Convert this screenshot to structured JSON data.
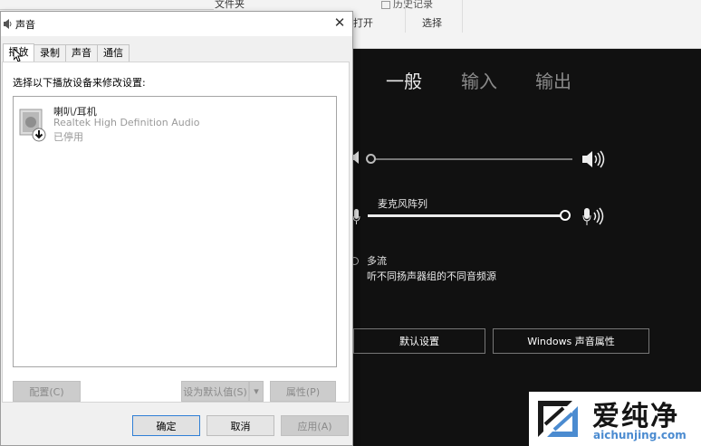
{
  "background_ribbon": {
    "folder_label": "文件夹",
    "open_label": "打开",
    "history_label": "历史记录",
    "select_label": "选择"
  },
  "settings_panel": {
    "tabs": [
      "一般",
      "输入",
      "输出"
    ],
    "output_volume_percent": 0,
    "mic_label": "麦克风阵列",
    "mic_volume_percent": 100,
    "multi_stream_label": "多流",
    "multi_stream_desc": "听不同扬声器组的不同音频源",
    "default_settings_button": "默认设置",
    "windows_sound_props_button": "Windows 声音属性"
  },
  "dialog": {
    "title": "声音",
    "tabs": [
      "播放",
      "录制",
      "声音",
      "通信"
    ],
    "instruction": "选择以下播放设备来修改设置:",
    "devices": [
      {
        "name": "喇叭/耳机",
        "driver": "Realtek High Definition Audio",
        "status": "已停用"
      }
    ],
    "buttons": {
      "configure": "配置(C)",
      "set_default": "设为默认值(S)",
      "properties": "属性(P)",
      "ok": "确定",
      "cancel": "取消",
      "apply": "应用(A)"
    }
  },
  "watermark": {
    "brand": "爱纯净",
    "url": "aichunjing.com"
  }
}
